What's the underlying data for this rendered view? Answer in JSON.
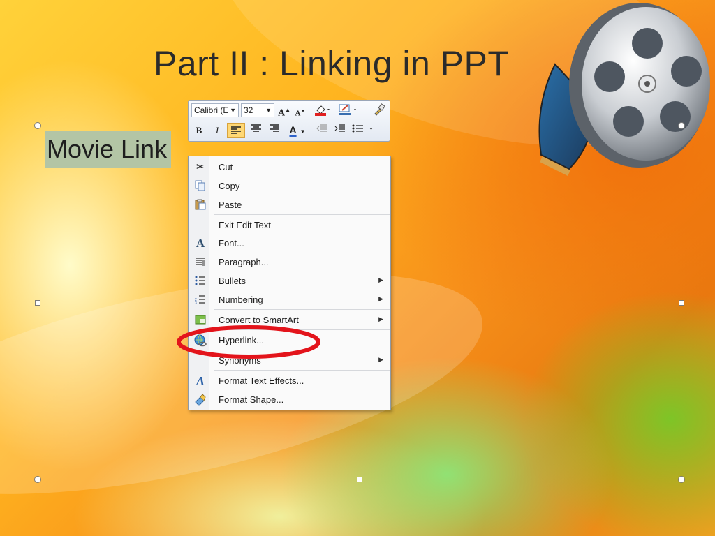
{
  "slide": {
    "title": "Part II : Linking in PPT",
    "textbox_text": "Movie Link"
  },
  "minibar": {
    "font_name": "Calibri (E",
    "font_size": "32",
    "grow_font": "A",
    "shrink_font": "A",
    "bold": "B",
    "italic": "I",
    "font_color": "A"
  },
  "menu": {
    "items": [
      {
        "label": "Cut",
        "icon": "scissors-icon"
      },
      {
        "label": "Copy",
        "icon": "copy-icon"
      },
      {
        "label": "Paste",
        "icon": "paste-icon"
      },
      {
        "label": "Exit Edit Text",
        "icon": ""
      },
      {
        "label": "Font...",
        "icon": "font-icon"
      },
      {
        "label": "Paragraph...",
        "icon": "paragraph-icon"
      },
      {
        "label": "Bullets",
        "icon": "bullets-icon",
        "submenu": true
      },
      {
        "label": "Numbering",
        "icon": "numbering-icon",
        "submenu": true
      },
      {
        "label": "Convert to SmartArt",
        "icon": "smartart-icon",
        "submenu": true
      },
      {
        "label": "Hyperlink...",
        "icon": "hyperlink-icon"
      },
      {
        "label": "Synonyms",
        "icon": "",
        "submenu": true
      },
      {
        "label": "Format Text Effects...",
        "icon": "text-effects-icon"
      },
      {
        "label": "Format Shape...",
        "icon": "format-shape-icon"
      }
    ]
  },
  "colors": {
    "highlight_ellipse": "#e3141b",
    "selected_text_bg": "#b3c5a5"
  }
}
